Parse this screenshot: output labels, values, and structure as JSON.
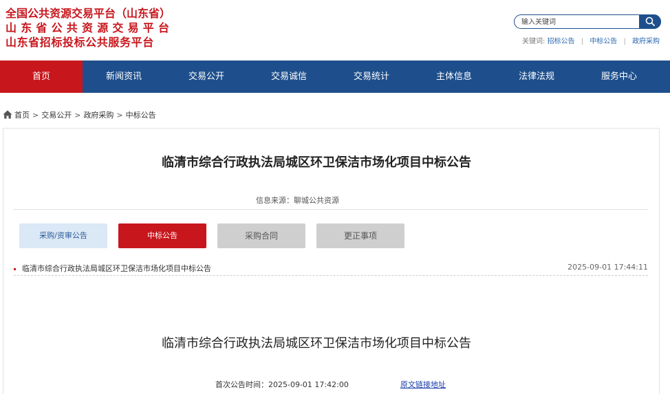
{
  "header": {
    "logo_lines": [
      "全国公共资源交易平台（山东省）",
      "山东省公共资源交易平台",
      "山东省招标投标公共服务平台"
    ],
    "search": {
      "placeholder": "输入关键词",
      "value": ""
    },
    "keywords_label": "关键词:",
    "keywords": [
      "招标公告",
      "中标公告",
      "政府采购"
    ]
  },
  "nav": {
    "items": [
      "首页",
      "新闻资讯",
      "交易公开",
      "交易诚信",
      "交易统计",
      "主体信息",
      "法律法规",
      "服务中心"
    ],
    "active_index": 0
  },
  "breadcrumb": [
    "首页",
    "交易公开",
    "政府采购",
    "中标公告"
  ],
  "article": {
    "title": "临清市综合行政执法局城区环卫保洁市场化项目中标公告",
    "source": "信息来源：聊城公共资源",
    "tabs": [
      "采购/资审公告",
      "中标公告",
      "采购合同",
      "更正事项"
    ],
    "active_tab": 1,
    "list": [
      {
        "title": "临清市综合行政执法局城区环卫保洁市场化项目中标公告",
        "date": "2025-09-01 17:44:11"
      }
    ],
    "doc_title": "临清市综合行政执法局城区环卫保洁市场化项目中标公告",
    "first_publish": "首次公告时间：2025-09-01 17:42:00",
    "original_link": "原文链接地址"
  },
  "colors": {
    "brand_red": "#c8161d",
    "nav_blue": "#1e4f8c",
    "tab_light_blue": "#dbe8f5",
    "tab_gray": "#cfcfcf"
  },
  "icons": {
    "search": "search-icon",
    "home": "home-icon"
  }
}
